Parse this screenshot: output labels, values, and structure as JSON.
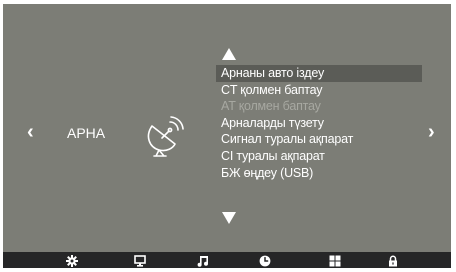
{
  "section": {
    "title": "АРНА",
    "icon": "satellite-dish-icon"
  },
  "navigation": {
    "left_icon": "chevron-left-icon",
    "right_icon": "chevron-right-icon",
    "left_glyph": "‹",
    "right_glyph": "›"
  },
  "menu": {
    "scroll_up_icon": "triangle-up-icon",
    "scroll_down_icon": "triangle-down-icon",
    "items": [
      {
        "label": "Арнаны авто іздеу",
        "state": "selected"
      },
      {
        "label": "CT қолмен баптау",
        "state": "normal"
      },
      {
        "label": "AT қолмен баптау",
        "state": "disabled"
      },
      {
        "label": "Арналарды түзету",
        "state": "normal"
      },
      {
        "label": "Сигнал туралы ақпарат",
        "state": "normal"
      },
      {
        "label": "CI туралы ақпарат",
        "state": "normal"
      },
      {
        "label": "БЖ өңдеу (USB)",
        "state": "normal"
      }
    ]
  },
  "bottom_bar": {
    "icons": [
      "gear-icon",
      "monitor-icon",
      "music-note-icon",
      "clock-icon",
      "grid-icon",
      "lock-icon"
    ]
  },
  "colors": {
    "background": "#7c7d76",
    "selected_row": "#5b5c57",
    "disabled_text": "#a7a8a1",
    "bottom_bar": "#262627",
    "text": "#ffffff"
  }
}
